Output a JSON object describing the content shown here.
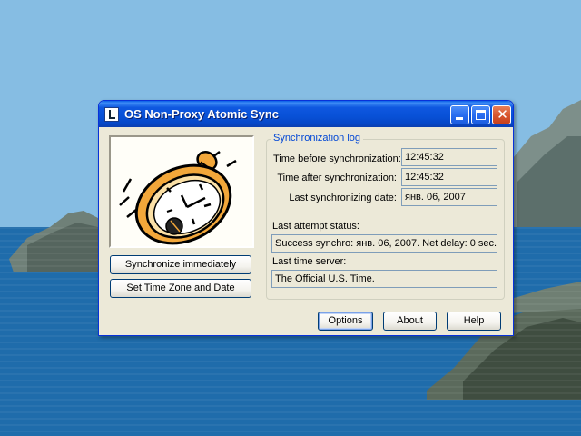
{
  "window": {
    "title": "OS Non-Proxy Atomic Sync",
    "accent_color": "#0a56dc"
  },
  "left_panel": {
    "image": "stopwatch-clipart",
    "sync_button_label": "Synchronize immediately",
    "timezone_button_label": "Set Time Zone and Date"
  },
  "log": {
    "group_title": "Synchronization log",
    "time_before_label": "Time before synchronization:",
    "time_before_value": "12:45:32",
    "time_after_label": "Time after synchronization:",
    "time_after_value": "12:45:32",
    "last_date_label": "Last synchronizing date:",
    "last_date_value": "янв. 06, 2007",
    "attempt_status_label": "Last attempt status:",
    "attempt_status_value": "Success synchro: янв. 06, 2007. Net delay: 0 sec.",
    "time_server_label": "Last time server:",
    "time_server_value": "The Official U.S. Time."
  },
  "footer": {
    "options_label": "Options",
    "about_label": "About",
    "help_label": "Help"
  }
}
